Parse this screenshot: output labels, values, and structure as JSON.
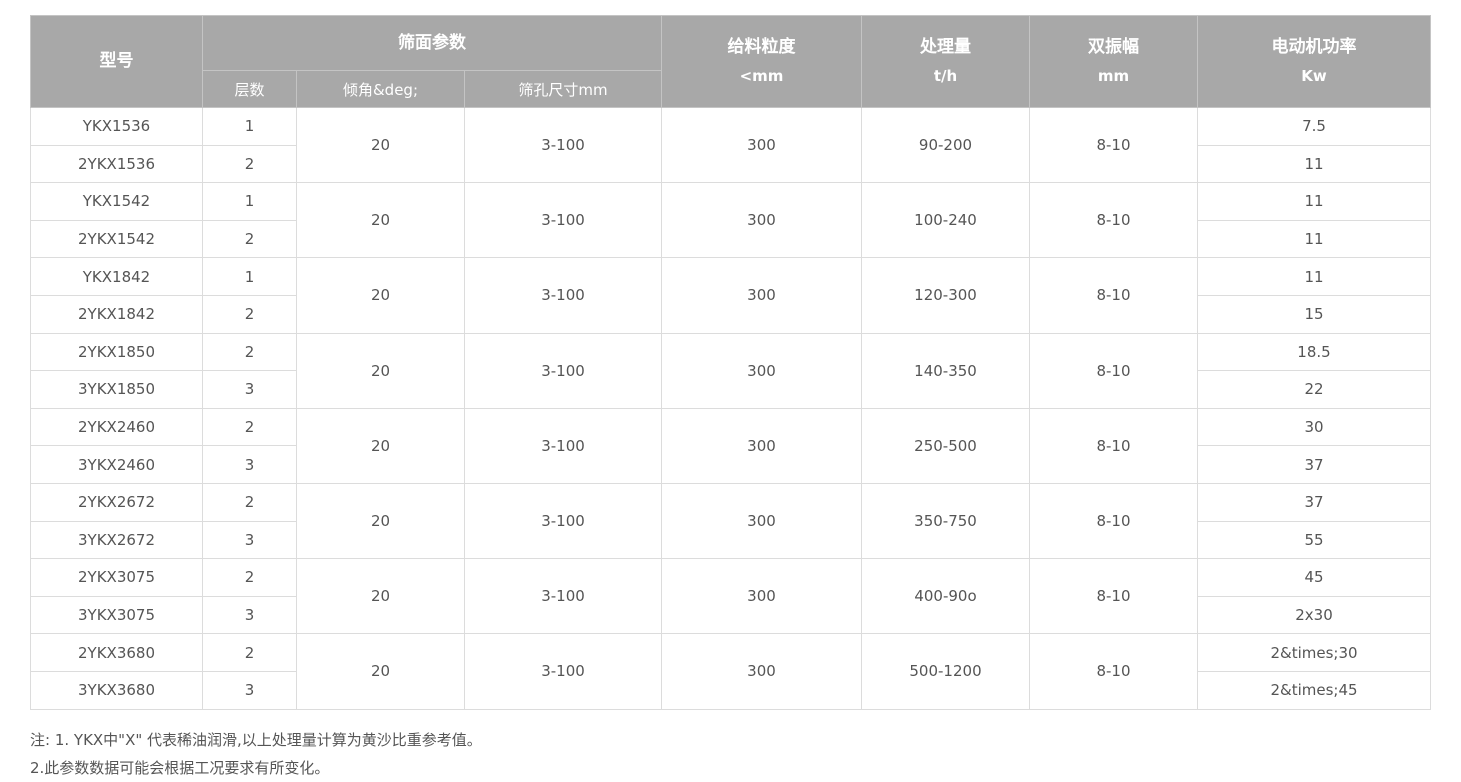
{
  "header": {
    "model": "型号",
    "screen_params": "筛面参数",
    "layers": "层数",
    "angle": "倾角&deg;",
    "aperture": "筛孔尺寸mm",
    "feed_size": {
      "title": "给料粒度",
      "unit": "<mm"
    },
    "capacity": {
      "title": "处理量",
      "unit": "t/h"
    },
    "amplitude": {
      "title": "双振幅",
      "unit": "mm"
    },
    "motor_power": {
      "title": "电动机功率",
      "unit": "Kw"
    }
  },
  "groups": [
    {
      "angle": "20",
      "aperture": "3-100",
      "feed": "300",
      "capacity": "90-200",
      "amplitude": "8-10",
      "rows": [
        {
          "model": "YKX1536",
          "layers": "1",
          "power": "7.5"
        },
        {
          "model": "2YKX1536",
          "layers": "2",
          "power": "11"
        }
      ]
    },
    {
      "angle": "20",
      "aperture": "3-100",
      "feed": "300",
      "capacity": "100-240",
      "amplitude": "8-10",
      "rows": [
        {
          "model": "YKX1542",
          "layers": "1",
          "power": "11"
        },
        {
          "model": "2YKX1542",
          "layers": "2",
          "power": "11"
        }
      ]
    },
    {
      "angle": "20",
      "aperture": "3-100",
      "feed": "300",
      "capacity": "120-300",
      "amplitude": "8-10",
      "rows": [
        {
          "model": "YKX1842",
          "layers": "1",
          "power": "11"
        },
        {
          "model": "2YKX1842",
          "layers": "2",
          "power": "15"
        }
      ]
    },
    {
      "angle": "20",
      "aperture": "3-100",
      "feed": "300",
      "capacity": "140-350",
      "amplitude": "8-10",
      "rows": [
        {
          "model": "2YKX1850",
          "layers": "2",
          "power": "18.5"
        },
        {
          "model": "3YKX1850",
          "layers": "3",
          "power": "22"
        }
      ]
    },
    {
      "angle": "20",
      "aperture": "3-100",
      "feed": "300",
      "capacity": "250-500",
      "amplitude": "8-10",
      "rows": [
        {
          "model": "2YKX2460",
          "layers": "2",
          "power": "30"
        },
        {
          "model": "3YKX2460",
          "layers": "3",
          "power": "37"
        }
      ]
    },
    {
      "angle": "20",
      "aperture": "3-100",
      "feed": "300",
      "capacity": "350-750",
      "amplitude": "8-10",
      "rows": [
        {
          "model": "2YKX2672",
          "layers": "2",
          "power": "37"
        },
        {
          "model": "3YKX2672",
          "layers": "3",
          "power": "55"
        }
      ]
    },
    {
      "angle": "20",
      "aperture": "3-100",
      "feed": "300",
      "capacity": "400-90o",
      "amplitude": "8-10",
      "rows": [
        {
          "model": "2YKX3075",
          "layers": "2",
          "power": "45"
        },
        {
          "model": "3YKX3075",
          "layers": "3",
          "power": "2x30"
        }
      ]
    },
    {
      "angle": "20",
      "aperture": "3-100",
      "feed": "300",
      "capacity": "500-1200",
      "amplitude": "8-10",
      "rows": [
        {
          "model": "2YKX3680",
          "layers": "2",
          "power": "2&times;30"
        },
        {
          "model": "3YKX3680",
          "layers": "3",
          "power": "2&times;45"
        }
      ]
    }
  ],
  "notes": [
    "注: 1. YKX中\"X\" 代表稀油润滑,以上处理量计算为黄沙比重参考值。",
    "2.此参数数据可能会根据工况要求有所变化。"
  ]
}
